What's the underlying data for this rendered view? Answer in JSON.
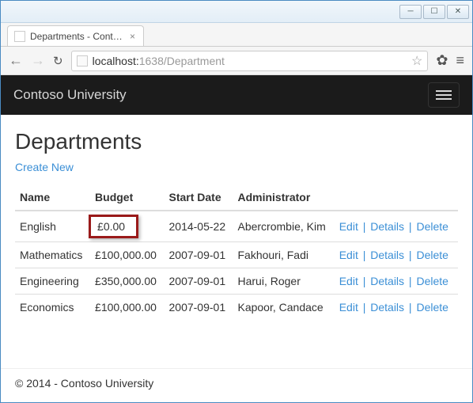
{
  "window": {
    "tab_title": "Departments - Contoso U"
  },
  "browser": {
    "url_host": "localhost:",
    "url_rest": "1638/Department"
  },
  "navbar": {
    "brand": "Contoso University"
  },
  "page": {
    "title": "Departments",
    "create_link": "Create New"
  },
  "table": {
    "headers": {
      "name": "Name",
      "budget": "Budget",
      "start_date": "Start Date",
      "admin": "Administrator"
    },
    "rows": [
      {
        "name": "English",
        "budget": "£0.00",
        "start_date": "2014-05-22",
        "admin": "Abercrombie, Kim",
        "highlight": true
      },
      {
        "name": "Mathematics",
        "budget": "£100,000.00",
        "start_date": "2007-09-01",
        "admin": "Fakhouri, Fadi"
      },
      {
        "name": "Engineering",
        "budget": "£350,000.00",
        "start_date": "2007-09-01",
        "admin": "Harui, Roger"
      },
      {
        "name": "Economics",
        "budget": "£100,000.00",
        "start_date": "2007-09-01",
        "admin": "Kapoor, Candace"
      }
    ],
    "actions": {
      "edit": "Edit",
      "details": "Details",
      "delete": "Delete"
    }
  },
  "footer": {
    "text": "© 2014 - Contoso University"
  }
}
